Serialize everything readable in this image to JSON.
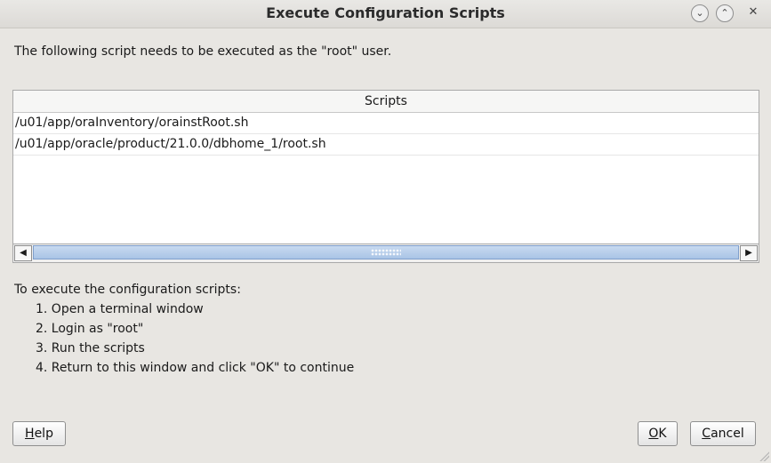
{
  "window": {
    "title": "Execute Configuration Scripts",
    "minimize_icon": "chevron-down-icon",
    "maximize_icon": "chevron-up-icon",
    "close_icon": "close-icon"
  },
  "message": "The following script needs to be executed as the \"root\" user.",
  "table": {
    "header": "Scripts",
    "rows": [
      "/u01/app/oraInventory/orainstRoot.sh",
      "/u01/app/oracle/product/21.0.0/dbhome_1/root.sh"
    ]
  },
  "instructions": {
    "heading": "To execute the configuration scripts:",
    "steps": [
      "1. Open a terminal window",
      "2. Login as \"root\"",
      "3. Run the scripts",
      "4. Return to this window and click \"OK\" to continue"
    ]
  },
  "buttons": {
    "help_mnemonic": "H",
    "help_rest": "elp",
    "ok_mnemonic": "O",
    "ok_rest": "K",
    "cancel_mnemonic": "C",
    "cancel_rest": "ancel"
  }
}
